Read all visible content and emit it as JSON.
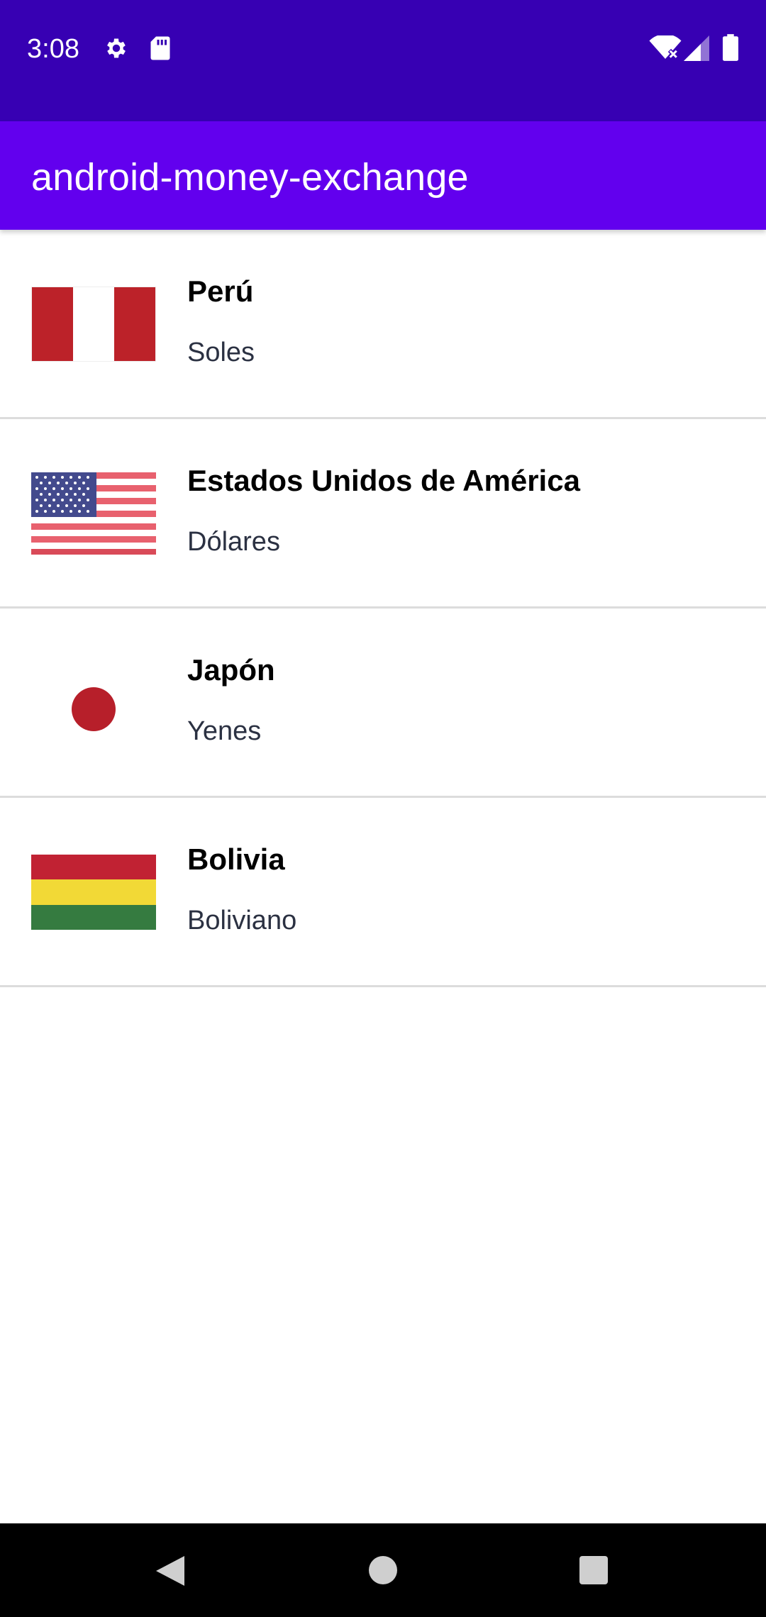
{
  "status_bar": {
    "time": "3:08",
    "icons": [
      "gear-icon",
      "sd-card-icon",
      "wifi-icon",
      "signal-icon",
      "battery-icon"
    ],
    "background": "#3700b3"
  },
  "app_bar": {
    "title": "android-money-exchange",
    "background": "#6200ee"
  },
  "countries": [
    {
      "name": "Perú",
      "currency": "Soles",
      "flag": "peru-flag-icon"
    },
    {
      "name": "Estados Unidos de América",
      "currency": "Dólares",
      "flag": "usa-flag-icon"
    },
    {
      "name": "Japón",
      "currency": "Yenes",
      "flag": "japan-flag-icon"
    },
    {
      "name": "Bolivia",
      "currency": "Boliviano",
      "flag": "bolivia-flag-icon"
    }
  ],
  "nav_bar": {
    "buttons": [
      "back-icon",
      "home-icon",
      "recents-icon"
    ]
  }
}
